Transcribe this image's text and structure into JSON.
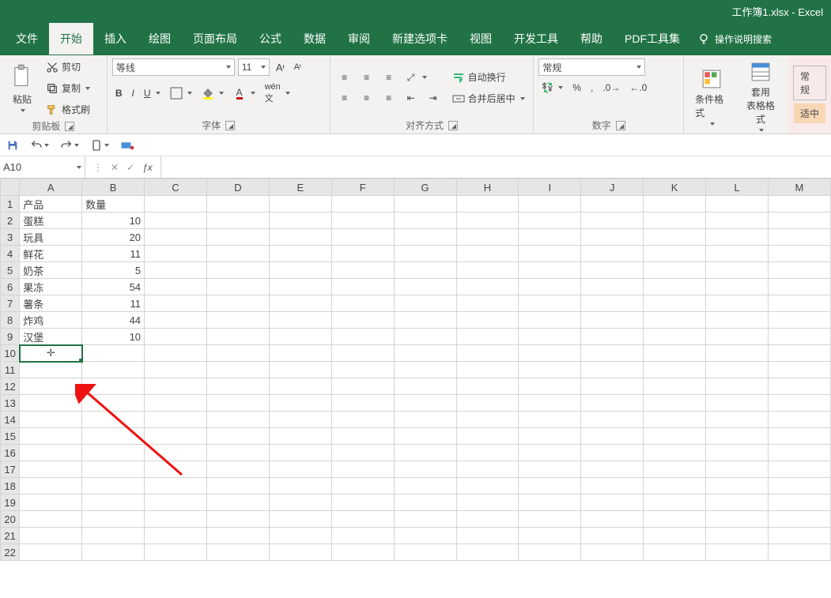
{
  "title": "工作簿1.xlsx - Excel",
  "menu": {
    "tabs": [
      "文件",
      "开始",
      "插入",
      "绘图",
      "页面布局",
      "公式",
      "数据",
      "审阅",
      "新建选项卡",
      "视图",
      "开发工具",
      "帮助",
      "PDF工具集"
    ],
    "active_index": 1,
    "tell_me_placeholder": "操作说明搜索"
  },
  "ribbon": {
    "clipboard": {
      "paste": "粘贴",
      "cut": "剪切",
      "copy": "复制",
      "format_painter": "格式刷",
      "group": "剪贴板"
    },
    "font": {
      "name": "等线",
      "size": "11",
      "group": "字体"
    },
    "alignment": {
      "wrap": "自动换行",
      "merge": "合并后居中",
      "group": "对齐方式"
    },
    "number": {
      "format": "常规",
      "group": "数字"
    },
    "styles": {
      "cond_format": "条件格式",
      "as_table": "套用\n表格格式"
    },
    "right": {
      "general": "常规",
      "fit": "适中"
    }
  },
  "name_box": "A10",
  "formula": "",
  "columns": [
    "A",
    "B",
    "C",
    "D",
    "E",
    "F",
    "G",
    "H",
    "I",
    "J",
    "K",
    "L",
    "M"
  ],
  "row_headers": [
    1,
    2,
    3,
    4,
    5,
    6,
    7,
    8,
    9,
    10,
    11,
    12,
    13,
    14,
    15,
    16,
    17,
    18,
    19,
    20,
    21,
    22
  ],
  "data": {
    "header": {
      "a": "产品",
      "b": "数量"
    },
    "rows": [
      {
        "a": "蛋糕",
        "b": 10
      },
      {
        "a": "玩具",
        "b": 20
      },
      {
        "a": "鲜花",
        "b": 11
      },
      {
        "a": "奶茶",
        "b": 5
      },
      {
        "a": "果冻",
        "b": 54
      },
      {
        "a": "薯条",
        "b": 11
      },
      {
        "a": "炸鸡",
        "b": 44
      },
      {
        "a": "汉堡",
        "b": 10
      }
    ]
  },
  "selected_cell": {
    "row": 10,
    "col": "A"
  },
  "icons": {
    "save": "save-icon",
    "undo": "undo-icon",
    "redo": "redo-icon",
    "scissors": "scissors-icon",
    "copy": "copy-icon",
    "brush": "brush-icon",
    "percent": "percent-icon",
    "comma": "comma-icon",
    "currency": "currency-icon",
    "bulb": "lightbulb-icon"
  }
}
